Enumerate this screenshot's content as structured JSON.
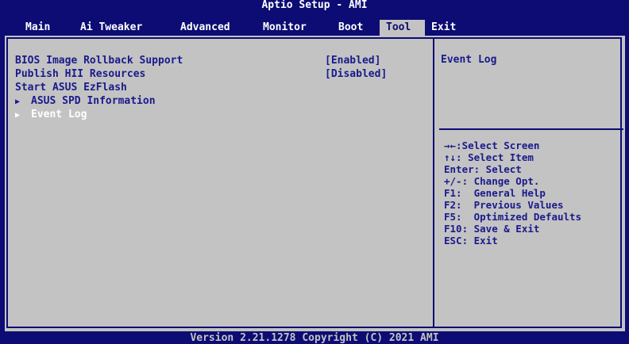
{
  "title": "Aptio Setup - AMI",
  "menu": [
    {
      "label": "Main"
    },
    {
      "label": "Ai Tweaker"
    },
    {
      "label": "Advanced"
    },
    {
      "label": "Monitor"
    },
    {
      "label": "Boot"
    },
    {
      "label": "Tool",
      "active": true
    },
    {
      "label": "Exit"
    }
  ],
  "items": [
    {
      "label": "BIOS Image Rollback Support",
      "value": "[Enabled]"
    },
    {
      "label": "Publish HII Resources",
      "value": "[Disabled]"
    },
    {
      "label": "Start ASUS EzFlash"
    },
    {
      "label": "ASUS SPD Information",
      "submenu": true
    },
    {
      "label": "Event Log",
      "submenu": true,
      "selected": true
    }
  ],
  "arrow_glyph": "▶",
  "help": {
    "title": "Event Log",
    "keys": [
      "→←:Select Screen",
      "↑↓: Select Item",
      "Enter: Select",
      "+/-: Change Opt.",
      "F1:  General Help",
      "F2:  Previous Values",
      "F5:  Optimized Defaults",
      "F10: Save & Exit",
      "ESC: Exit"
    ]
  },
  "footer": "Version 2.21.1278 Copyright (C) 2021 AMI",
  "colors": {
    "background": "#0c0c74",
    "panel": "#c3c3c3",
    "text": "#1a1a8c",
    "highlight_text": "#ffffff"
  }
}
